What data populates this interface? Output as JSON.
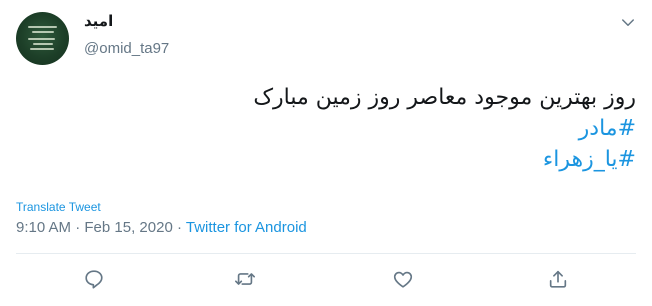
{
  "user": {
    "display_name": "امید",
    "username": "@omid_ta97"
  },
  "tweet": {
    "text_line": "روز بهترین موجود معاصر روز زمین مبارک",
    "hashtags": [
      "#مادر",
      "#یا_زهراء"
    ]
  },
  "translate_label": "Translate Tweet",
  "meta": {
    "time": "9:10 AM",
    "separator1": " · ",
    "date": "Feb 15, 2020",
    "separator2": " · ",
    "source": "Twitter for Android"
  },
  "icons": {
    "caret": "chevron-down-icon",
    "reply": "reply-icon",
    "retweet": "retweet-icon",
    "like": "like-icon",
    "share": "share-icon"
  },
  "colors": {
    "link": "#1b95e0",
    "secondary": "#657786",
    "text": "#14171a",
    "divider": "#e6ecf0"
  }
}
